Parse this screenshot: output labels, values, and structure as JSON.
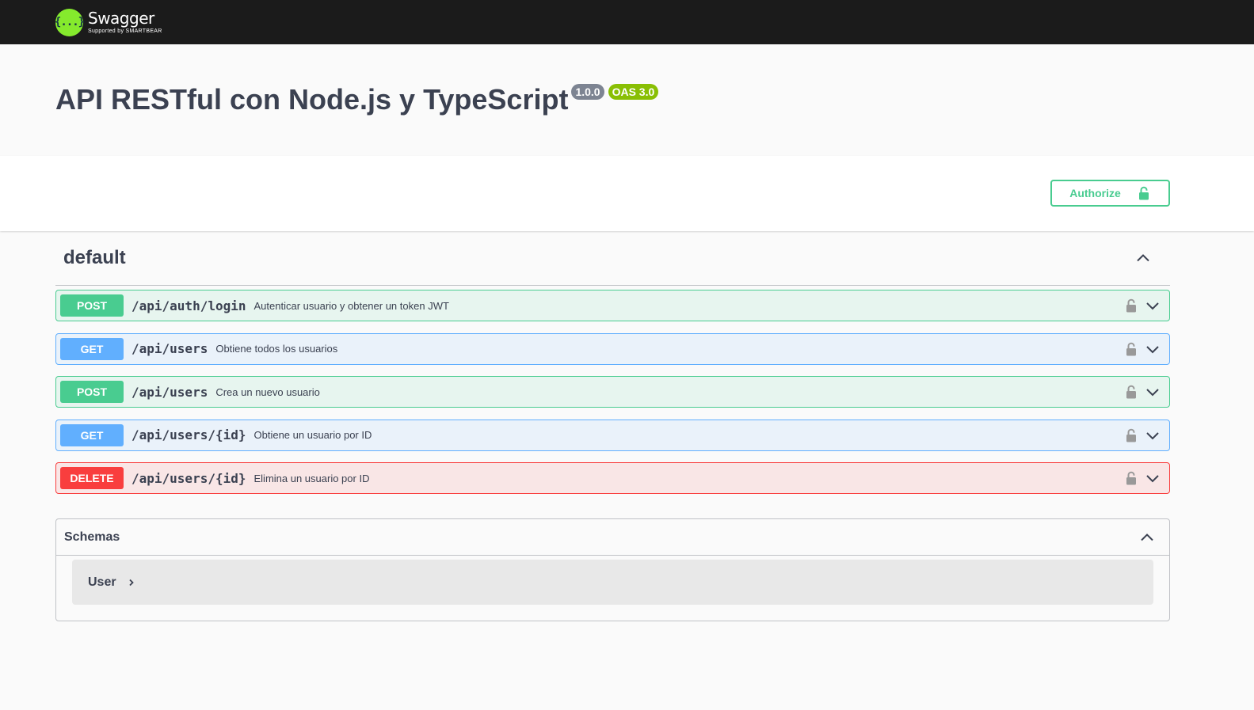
{
  "topbar": {
    "logo_name": "Swagger",
    "logo_sub": "Supported by SMARTBEAR",
    "logo_mark": "{...}"
  },
  "info": {
    "title": "API RESTful con Node.js y TypeScript",
    "version": "1.0.0",
    "oas": "OAS 3.0"
  },
  "scheme": {
    "authorize_label": "Authorize"
  },
  "tag": {
    "name": "default"
  },
  "operations": [
    {
      "method": "POST",
      "path": "/api/auth/login",
      "summary": "Autenticar usuario y obtener un token JWT"
    },
    {
      "method": "GET",
      "path": "/api/users",
      "summary": "Obtiene todos los usuarios"
    },
    {
      "method": "POST",
      "path": "/api/users",
      "summary": "Crea un nuevo usuario"
    },
    {
      "method": "GET",
      "path": "/api/users/{id}",
      "summary": "Obtiene un usuario por ID"
    },
    {
      "method": "DELETE",
      "path": "/api/users/{id}",
      "summary": "Elimina un usuario por ID"
    }
  ],
  "schemas": {
    "title": "Schemas",
    "models": [
      {
        "name": "User"
      }
    ]
  },
  "colors": {
    "post": "#49cc90",
    "get": "#61affe",
    "delete": "#f93e3e",
    "topbar": "#1b1b1b",
    "brand": "#85ea2d"
  },
  "icons": {
    "lock": "lock-icon",
    "chevron_down": "chevron-down-icon",
    "chevron_up": "chevron-up-icon",
    "chevron_right": "chevron-right-icon"
  }
}
